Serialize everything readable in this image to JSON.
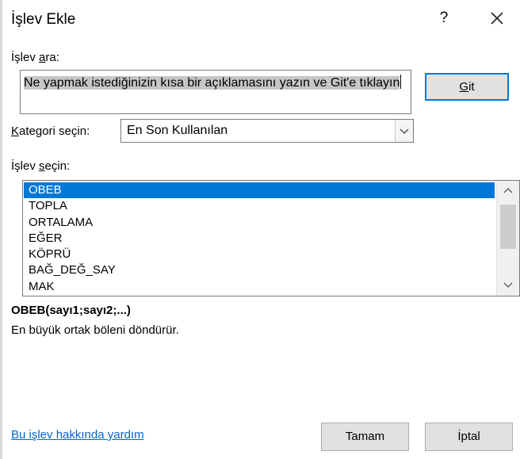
{
  "dialog": {
    "title": "İşlev Ekle",
    "help_symbol": "?"
  },
  "search": {
    "label_pre": "İşlev ",
    "label_key": "a",
    "label_post": "ra:",
    "text": "Ne yapmak istediğinizin kısa bir açıklamasını yazın ve Git'e tıklayın",
    "go_button_key": "G",
    "go_button_rest": "it"
  },
  "category": {
    "label_key": "K",
    "label_rest": "ategori seçin:",
    "selected": "En Son Kullanılan"
  },
  "functions": {
    "label_pre": "İşlev ",
    "label_key": "s",
    "label_post": "eçin:",
    "items": [
      "OBEB",
      "TOPLA",
      "ORTALAMA",
      "EĞER",
      "KÖPRÜ",
      "BAĞ_DEĞ_SAY",
      "MAK"
    ],
    "selected_index": 0
  },
  "details": {
    "syntax": "OBEB(sayı1;sayı2;...)",
    "description": "En büyük ortak böleni döndürür."
  },
  "footer": {
    "help_link": "Bu işlev hakkında yardım",
    "ok_label": "Tamam",
    "cancel_label": "İptal"
  },
  "colors": {
    "selection": "#0078d7",
    "link": "#0066cc",
    "button_face": "#e1e1e1",
    "default_button_border": "#0078d7"
  }
}
